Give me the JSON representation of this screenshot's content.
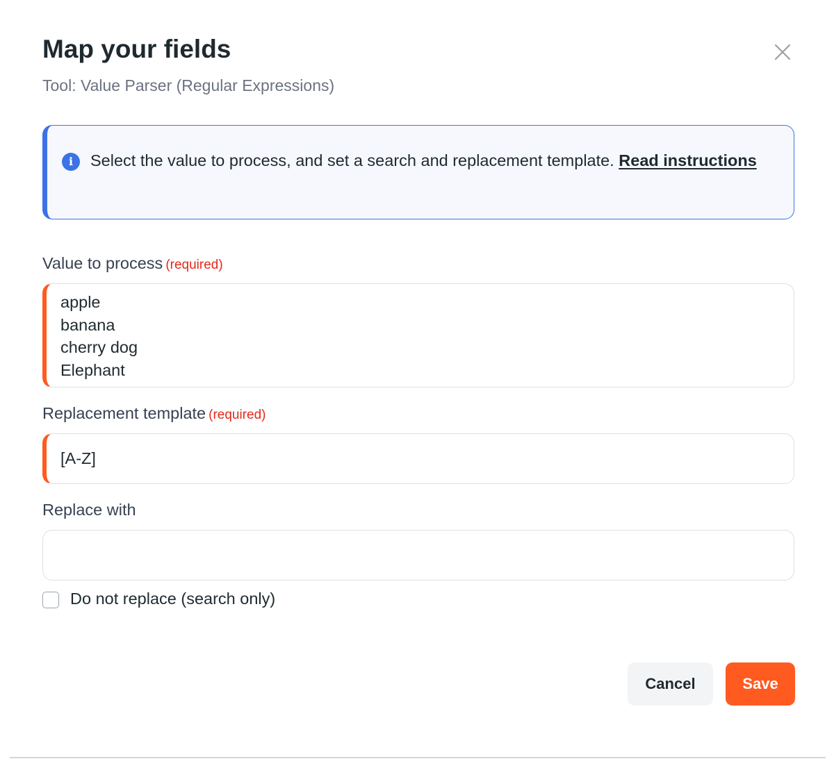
{
  "dialog": {
    "title": "Map your fields",
    "subtitle": "Tool: Value Parser (Regular Expressions)",
    "close_icon": "close-icon"
  },
  "info": {
    "icon": "info-icon",
    "icon_glyph": "i",
    "text": "Select the value to process, and set a search and replacement template. ",
    "link_text": "Read instructions",
    "accent_color": "#3b73e6"
  },
  "fields": {
    "value_to_process": {
      "label": "Value to process",
      "required_text": "(required)",
      "value": "apple\nbanana\ncherry dog\nElephant"
    },
    "replacement_template": {
      "label": "Replacement template",
      "required_text": "(required)",
      "value": "[A-Z]"
    },
    "replace_with": {
      "label": "Replace with",
      "value": ""
    }
  },
  "search_only": {
    "label": "Do not replace (search only)",
    "checked": false
  },
  "buttons": {
    "cancel": "Cancel",
    "save": "Save"
  },
  "colors": {
    "brand": "#ff5a1f",
    "required": "#e5271a",
    "info": "#3b73e6"
  }
}
